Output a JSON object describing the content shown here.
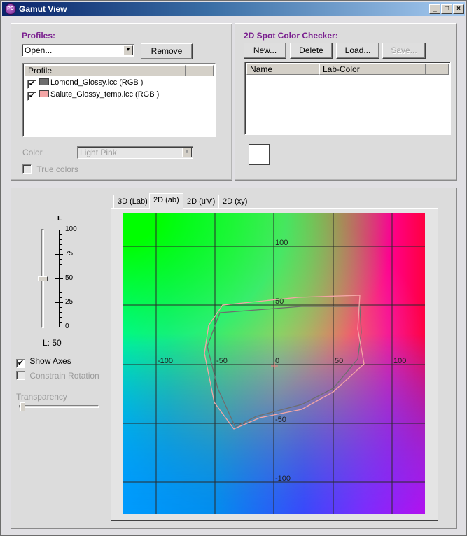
{
  "window": {
    "app_icon": "PC",
    "title": "Gamut View",
    "controls": {
      "minimize": "_",
      "maximize": "□",
      "close": "×"
    }
  },
  "profiles": {
    "heading": "Profiles:",
    "open_combo_value": "Open...",
    "remove_button": "Remove",
    "list_header": "Profile",
    "items": [
      {
        "checked": true,
        "swatch_color": "#6e6e6e",
        "label": "Lomond_Glossy.icc (RGB )"
      },
      {
        "checked": true,
        "swatch_color": "#f4a6a6",
        "label": "Salute_Glossy_temp.icc (RGB )"
      }
    ],
    "color_label": "Color",
    "color_value": "Light Pink",
    "true_colors_label": "True colors"
  },
  "spot_checker": {
    "heading": "2D Spot Color Checker:",
    "new_button": "New...",
    "delete_button": "Delete",
    "load_button": "Load...",
    "save_button": "Save...",
    "columns": [
      "Name",
      "Lab-Color"
    ]
  },
  "lightness": {
    "axis_label": "L",
    "ticks": [
      "100",
      "75",
      "50",
      "25",
      "0"
    ],
    "value_text": "L: 50",
    "value": 50
  },
  "options": {
    "show_axes_label": "Show Axes",
    "show_axes_checked": true,
    "constrain_rotation_label": "Constrain Rotation",
    "transparency_label": "Transparency",
    "transparency_value": 0
  },
  "tabs": [
    {
      "label": "3D (Lab)",
      "active": false
    },
    {
      "label": "2D (ab)",
      "active": true
    },
    {
      "label": "2D (u'v')",
      "active": false
    },
    {
      "label": "2D (xy)",
      "active": false
    }
  ],
  "plot_labels": {
    "a_ticks": [
      "-100",
      "-50",
      "0",
      "50",
      "100"
    ],
    "b_ticks": [
      "100",
      "50",
      "-50",
      "-100"
    ]
  },
  "colors": {
    "heading_purple": "#7a1f8f",
    "gamut_lomond": "#6e6e6e",
    "gamut_salute": "#f4a6a6"
  }
}
